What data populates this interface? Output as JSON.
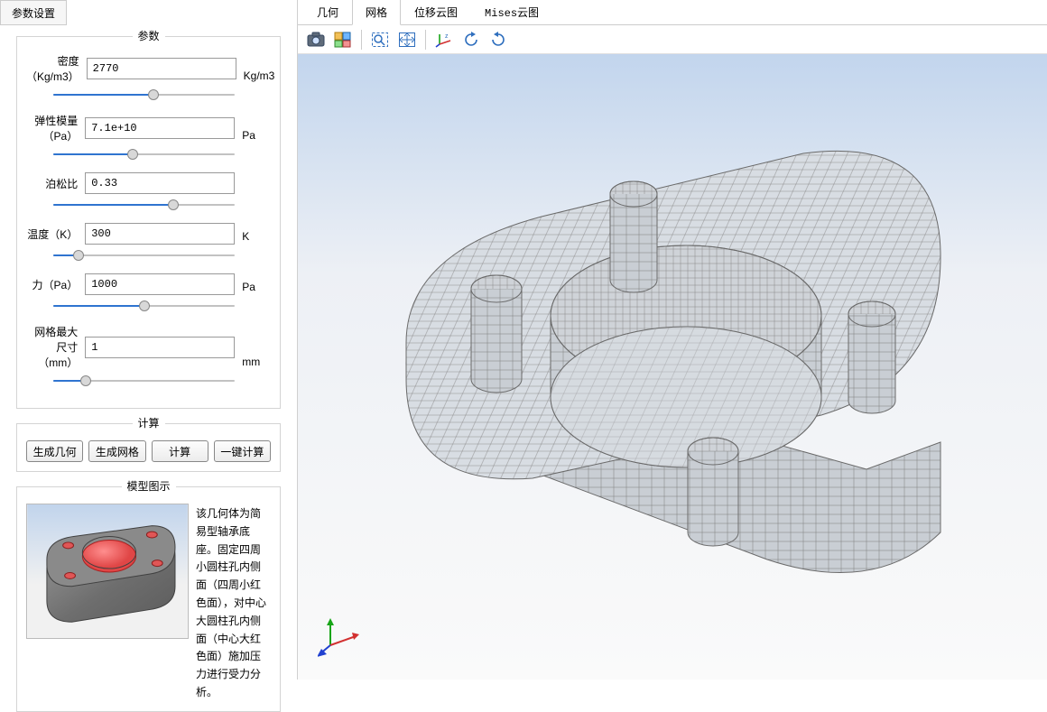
{
  "sidebar": {
    "tab_label": "参数设置",
    "params_group_label": "参数",
    "params": [
      {
        "label": "密度（Kg/m3）",
        "value": "2770",
        "unit": "Kg/m3",
        "slider_pct": 55
      },
      {
        "label": "弹性模量（Pa）",
        "value": "7.1e+10",
        "unit": "Pa",
        "slider_pct": 44
      },
      {
        "label": "泊松比",
        "value": "0.33",
        "unit": "",
        "slider_pct": 66
      },
      {
        "label": "温度（K）",
        "value": "300",
        "unit": "K",
        "slider_pct": 14
      },
      {
        "label": "力（Pa）",
        "value": "1000",
        "unit": "Pa",
        "slider_pct": 50
      },
      {
        "label": "网格最大尺寸（mm）",
        "value": "1",
        "unit": "mm",
        "slider_pct": 18
      }
    ],
    "compute_group_label": "计算",
    "compute_buttons": [
      "生成几何",
      "生成网格",
      "计算",
      "一键计算"
    ],
    "model_group_label": "模型图示",
    "model_description": "该几何体为简易型轴承底座。固定四周小圆柱孔内侧面（四周小红色面），对中心大圆柱孔内侧面（中心大红色面）施加压力进行受力分析。"
  },
  "view": {
    "tabs": [
      "几何",
      "网格",
      "位移云图",
      "Mises云图"
    ],
    "active_tab_index": 1,
    "toolbar_icons": [
      "camera-icon",
      "screenshot-options-icon",
      "_sep",
      "zoom-rect-icon",
      "fit-view-icon",
      "_sep",
      "show-axes-icon",
      "rotate-ccw-icon",
      "rotate-cw-icon"
    ]
  },
  "colors": {
    "accent": "#2f74d0",
    "bg_gradient_top": "#c2d5ed",
    "bg_gradient_bottom": "#fafafa",
    "mesh_wire": "#8c8c8c",
    "mesh_face": "#d9dee4"
  }
}
